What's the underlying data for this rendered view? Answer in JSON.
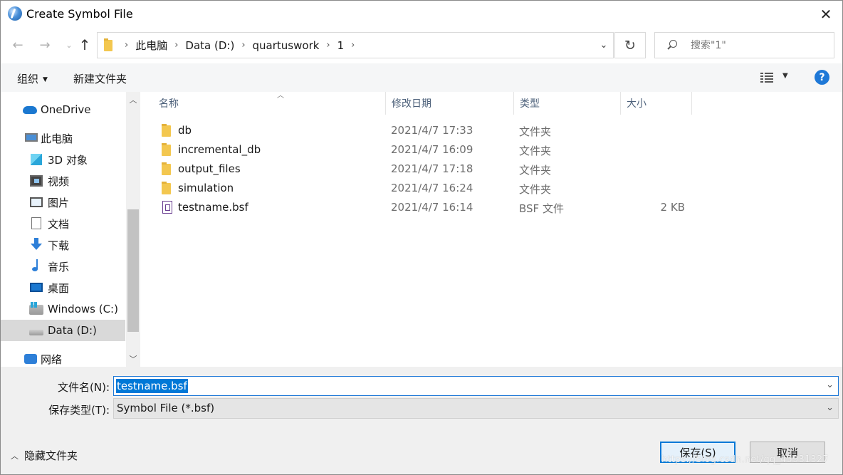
{
  "window": {
    "title": "Create Symbol File"
  },
  "nav": {
    "breadcrumbs": [
      "此电脑",
      "Data (D:)",
      "quartuswork",
      "1"
    ],
    "search_placeholder": "搜索\"1\""
  },
  "commandbar": {
    "organize": "组织",
    "new_folder": "新建文件夹"
  },
  "sidebar": {
    "items": [
      {
        "label": "OneDrive",
        "icon": "onedrive-icon"
      },
      {
        "label": "此电脑",
        "icon": "this-pc-icon"
      },
      {
        "label": "3D 对象",
        "icon": "3d-objects-icon"
      },
      {
        "label": "视频",
        "icon": "videos-icon"
      },
      {
        "label": "图片",
        "icon": "pictures-icon"
      },
      {
        "label": "文档",
        "icon": "documents-icon"
      },
      {
        "label": "下载",
        "icon": "downloads-icon"
      },
      {
        "label": "音乐",
        "icon": "music-icon"
      },
      {
        "label": "桌面",
        "icon": "desktop-icon"
      },
      {
        "label": "Windows (C:)",
        "icon": "windows-drive-icon"
      },
      {
        "label": "Data (D:)",
        "icon": "drive-icon",
        "selected": true
      },
      {
        "label": "网络",
        "icon": "network-icon"
      }
    ]
  },
  "filelist": {
    "columns": {
      "name": "名称",
      "date": "修改日期",
      "type": "类型",
      "size": "大小"
    },
    "rows": [
      {
        "name": "db",
        "date": "2021/4/7 17:33",
        "type": "文件夹",
        "size": "",
        "kind": "folder"
      },
      {
        "name": "incremental_db",
        "date": "2021/4/7 16:09",
        "type": "文件夹",
        "size": "",
        "kind": "folder"
      },
      {
        "name": "output_files",
        "date": "2021/4/7 17:18",
        "type": "文件夹",
        "size": "",
        "kind": "folder"
      },
      {
        "name": "simulation",
        "date": "2021/4/7 16:24",
        "type": "文件夹",
        "size": "",
        "kind": "folder"
      },
      {
        "name": "testname.bsf",
        "date": "2021/4/7 16:14",
        "type": "BSF 文件",
        "size": "2 KB",
        "kind": "bsf"
      }
    ]
  },
  "form": {
    "filename_label": "文件名(N):",
    "filename_value": "testname.bsf",
    "filetype_label": "保存类型(T):",
    "filetype_value": "Symbol File (*.bsf)"
  },
  "footer": {
    "hide_folders": "隐藏文件夹",
    "save": "保存(S)",
    "cancel": "取消",
    "watermark": "https://blog.csdn.net/qq_45931327"
  }
}
